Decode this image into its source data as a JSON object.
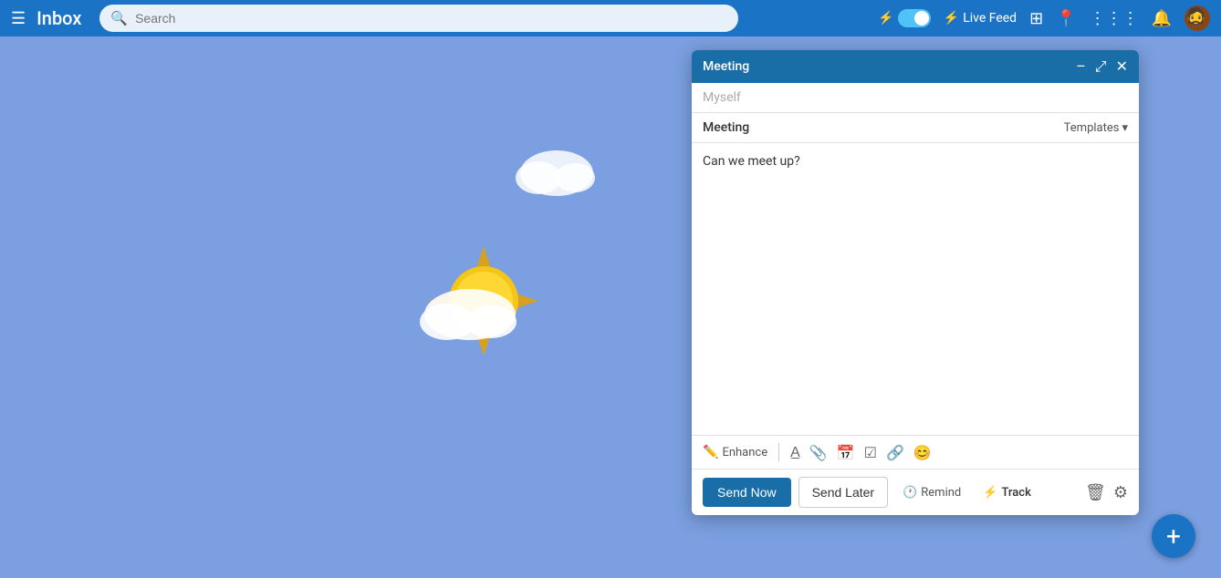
{
  "header": {
    "menu_label": "☰",
    "title": "Inbox",
    "search_placeholder": "Search",
    "live_feed_label": "Live Feed",
    "toggle_on": true
  },
  "compose": {
    "window_title": "Meeting",
    "to_placeholder": "Myself",
    "subject": "Meeting",
    "templates_label": "Templates",
    "body_text": "Can we meet up?",
    "enhance_label": "Enhance",
    "send_now_label": "Send Now",
    "send_later_label": "Send Later",
    "remind_label": "Remind",
    "track_label": "Track"
  },
  "fab": {
    "label": "+"
  }
}
